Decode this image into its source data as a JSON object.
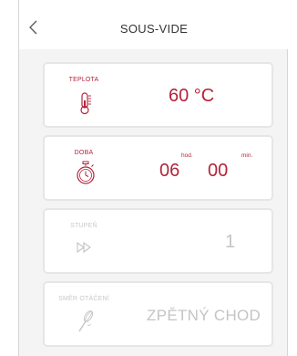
{
  "header": {
    "title": "SOUS-VIDE",
    "back_icon": "chevron-left-icon"
  },
  "colors": {
    "accent": "#b3243a",
    "disabled": "#c4c4c4"
  },
  "cards": [
    {
      "id": "temperature",
      "label": "TEPLOTA",
      "icon": "thermometer-icon",
      "value": "60 °C"
    },
    {
      "id": "duration",
      "label": "DOBA",
      "icon": "stopwatch-icon",
      "hours": "06",
      "hours_unit": "hod.",
      "minutes": "00",
      "minutes_unit": "min."
    },
    {
      "id": "level",
      "label": "STUPEŇ",
      "icon": "fast-forward-icon",
      "value": "1"
    },
    {
      "id": "rotation",
      "label": "SMĚR OTÁČENÍ",
      "icon": "whisk-icon",
      "value": "ZPĚTNÝ CHOD"
    }
  ]
}
